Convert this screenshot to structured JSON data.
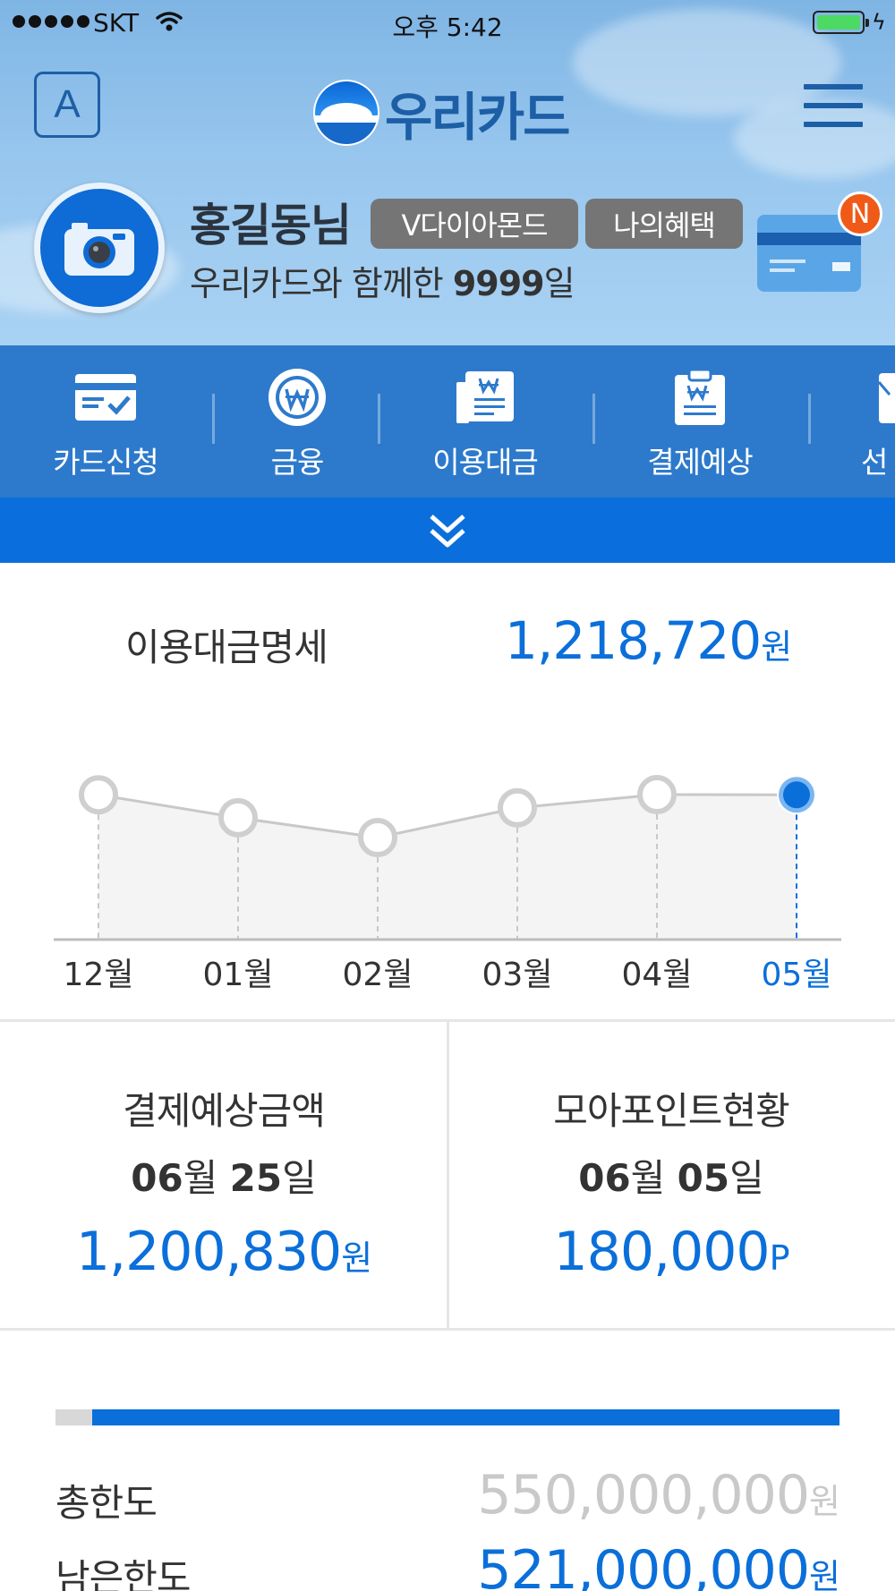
{
  "status_bar": {
    "carrier": "SKT",
    "time": "오후 5:42"
  },
  "header": {
    "font_button": "A",
    "logo_text": "우리카드"
  },
  "profile": {
    "name": "홍길동님",
    "grade_badge": "V다이아몬드",
    "benefit_badge": "나의혜택",
    "days_prefix": "우리카드와 함께한 ",
    "days_count": "9999",
    "days_suffix": "일",
    "notification_badge": "N"
  },
  "quick_menu": {
    "items": [
      {
        "label": "카드신청",
        "icon": "card-apply-icon"
      },
      {
        "label": "금융",
        "icon": "won-coin-icon"
      },
      {
        "label": "이용대금",
        "icon": "bill-icon"
      },
      {
        "label": "결제예상",
        "icon": "payment-clipboard-icon"
      },
      {
        "label": "선",
        "icon": "partial-menu-icon"
      }
    ]
  },
  "statement": {
    "label": "이용대금명세",
    "amount": "1,218,720",
    "unit": "원"
  },
  "chart_data": {
    "type": "line",
    "categories": [
      "12월",
      "01월",
      "02월",
      "03월",
      "04월",
      "05월"
    ],
    "values": [
      1218720,
      1080000,
      960000,
      1140000,
      1220000,
      1218720
    ],
    "selected_index": 5,
    "accent_color": "#0b6fda",
    "grid": false,
    "legend": "none"
  },
  "summary": {
    "payment": {
      "title": "결제예상금액",
      "date_month": "06",
      "date_month_unit": "월 ",
      "date_day": "25",
      "date_day_unit": "일",
      "amount": "1,200,830",
      "unit": "원"
    },
    "points": {
      "title": "모아포인트현황",
      "date_month": "06",
      "date_month_unit": "월 ",
      "date_day": "05",
      "date_day_unit": "일",
      "amount": "180,000",
      "unit": "P"
    }
  },
  "limits": {
    "used_fraction": 0.047,
    "total_label": "총한도",
    "total_value": "550,000,000",
    "total_unit": "원",
    "remaining_label": "남은한도",
    "remaining_value": "521,000,000",
    "remaining_unit": "원"
  }
}
